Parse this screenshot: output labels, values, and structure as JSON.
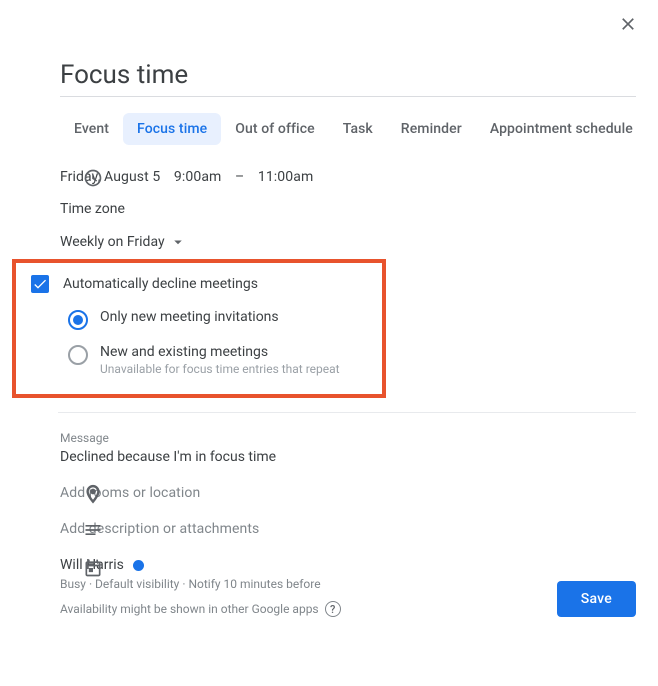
{
  "title": "Focus time",
  "tabs": [
    {
      "label": "Event"
    },
    {
      "label": "Focus time",
      "active": true
    },
    {
      "label": "Out of office"
    },
    {
      "label": "Task"
    },
    {
      "label": "Reminder"
    },
    {
      "label": "Appointment schedule"
    }
  ],
  "time": {
    "date": "Friday, August 5",
    "start": "9:00am",
    "separator": "–",
    "end": "11:00am",
    "timezone_label": "Time zone",
    "recurrence": "Weekly on Friday"
  },
  "decline": {
    "checkbox_label": "Automatically decline meetings",
    "checked": true,
    "options": [
      {
        "label": "Only new meeting invitations",
        "sub": "",
        "selected": true
      },
      {
        "label": "New and existing meetings",
        "sub": "Unavailable for focus time entries that repeat",
        "selected": false
      }
    ]
  },
  "message": {
    "label": "Message",
    "value": "Declined because I'm in focus time"
  },
  "location_placeholder": "Add rooms or location",
  "description_placeholder": "Add description or attachments",
  "calendar": {
    "owner": "Will Harris",
    "status_color": "#1a73e8",
    "details": "Busy · Default visibility · Notify 10 minutes before",
    "availability_note": "Availability might be shown in other Google apps"
  },
  "save_label": "Save"
}
